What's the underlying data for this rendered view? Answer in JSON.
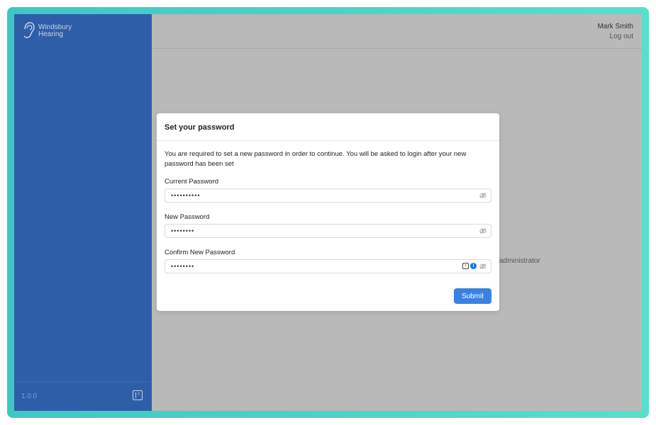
{
  "app": {
    "brand_line1": "Windsbury",
    "brand_line2": "Hearing",
    "version": "1.0.0"
  },
  "header": {
    "user_name": "Mark Smith",
    "logout_label": "Log out"
  },
  "background": {
    "partial_text": "administrator"
  },
  "modal": {
    "title": "Set your password",
    "description": "You are required to set a new password in order to continue. You will be asked to login after your new password has been set",
    "fields": [
      {
        "label": "Current Password",
        "value": "••••••••••"
      },
      {
        "label": "New Password",
        "value": "••••••••"
      },
      {
        "label": "Confirm New Password",
        "value": "••••••••"
      }
    ],
    "submit_label": "Submit"
  },
  "colors": {
    "sidebar": "#2f5ea8",
    "accent": "#3b82e0",
    "frame": "#3ec8c4",
    "overlay": "#b9b9b9"
  },
  "icons": [
    "ear-logo-icon",
    "collapse-sidebar-icon",
    "eye-off-icon",
    "password-manager-lock-icon",
    "password-manager-info-icon"
  ]
}
